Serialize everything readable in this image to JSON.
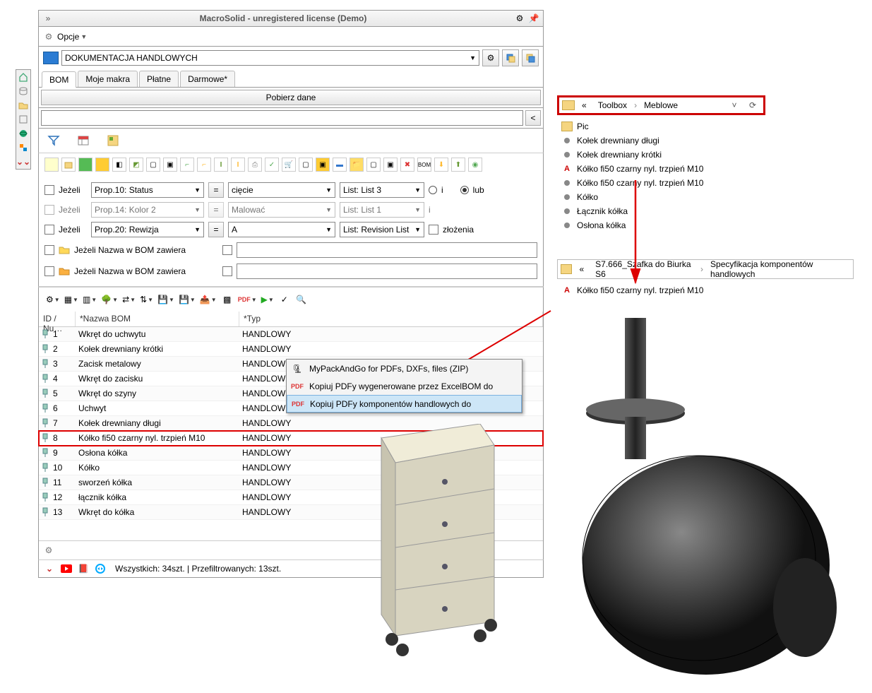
{
  "app": {
    "title": "MacroSolid - unregistered license (Demo)"
  },
  "options": {
    "label": "Opcje"
  },
  "docCombo": {
    "value": "DOKUMENTACJA HANDLOWYCH"
  },
  "tabs": [
    {
      "label": "BOM",
      "active": true
    },
    {
      "label": "Moje makra"
    },
    {
      "label": "Płatne"
    },
    {
      "label": "Darmowe*"
    }
  ],
  "fetch": {
    "label": "Pobierz dane"
  },
  "searchBtn": {
    "label": "<"
  },
  "filters": {
    "jezeli": "Jeżeli",
    "row1": {
      "prop": "Prop.10: Status",
      "op": "=",
      "val": "cięcie",
      "list": "List: List 3"
    },
    "row2": {
      "prop": "Prop.14: Kolor 2",
      "op": "=",
      "val": "Malować",
      "list": "List: List 1"
    },
    "row3": {
      "prop": "Prop.20: Rewizja",
      "op": "=",
      "val": "A",
      "list": "List: Revision List"
    },
    "iLabel": "i",
    "lubLabel": "lub",
    "zlozenia": "złożenia",
    "nameContains": "Jeżeli Nazwa w BOM zawiera"
  },
  "grid": {
    "head": {
      "id": "ID / Nu…",
      "name": "*Nazwa BOM",
      "typ": "*Typ"
    },
    "rows": [
      {
        "id": "1",
        "name": "Wkręt do uchwytu",
        "typ": "HANDLOWY"
      },
      {
        "id": "2",
        "name": "Kołek drewniany krótki",
        "typ": "HANDLOWY"
      },
      {
        "id": "3",
        "name": "Zacisk metalowy",
        "typ": "HANDLOWY"
      },
      {
        "id": "4",
        "name": "Wkręt do zacisku",
        "typ": "HANDLOWY"
      },
      {
        "id": "5",
        "name": "Wkręt do szyny",
        "typ": "HANDLOWY"
      },
      {
        "id": "6",
        "name": "Uchwyt",
        "typ": "HANDLOWY"
      },
      {
        "id": "7",
        "name": "Kołek drewniany długi",
        "typ": "HANDLOWY"
      },
      {
        "id": "8",
        "name": "Kółko fi50 czarny nyl. trzpień M10",
        "typ": "HANDLOWY",
        "hl": true
      },
      {
        "id": "9",
        "name": "Osłona kółka",
        "typ": "HANDLOWY"
      },
      {
        "id": "10",
        "name": "Kółko",
        "typ": "HANDLOWY"
      },
      {
        "id": "11",
        "name": "sworzeń kółka",
        "typ": "HANDLOWY"
      },
      {
        "id": "12",
        "name": "łącznik kółka",
        "typ": "HANDLOWY"
      },
      {
        "id": "13",
        "name": "Wkręt do kółka",
        "typ": "HANDLOWY"
      }
    ]
  },
  "status": {
    "text": "Wszystkich: 34szt. | Przefiltrowanych: 13szt."
  },
  "context": {
    "items": [
      {
        "label": "MyPackAndGo for PDFs, DXFs, files (ZIP)"
      },
      {
        "label": "Kopiuj PDFy wygenerowane przez ExcelBOM do"
      },
      {
        "label": "Kopiuj PDFy komponentów handlowych do",
        "sel": true
      }
    ]
  },
  "explorer1": {
    "crumbs": [
      "«",
      "Toolbox",
      "Meblowe"
    ],
    "items": [
      {
        "ico": "folder",
        "label": "Pic"
      },
      {
        "ico": "part",
        "label": "Kołek drewniany długi"
      },
      {
        "ico": "part",
        "label": "Kołek drewniany krótki"
      },
      {
        "ico": "pdf",
        "label": "Kółko fi50 czarny nyl. trzpień M10"
      },
      {
        "ico": "part",
        "label": "Kółko fi50 czarny nyl. trzpień M10"
      },
      {
        "ico": "part",
        "label": "Kółko"
      },
      {
        "ico": "part",
        "label": "Łącznik kółka"
      },
      {
        "ico": "part",
        "label": "Osłona kółka"
      }
    ]
  },
  "explorer2": {
    "crumbs": [
      "«",
      "S7.666_Szafka do Biurka S6",
      "Specyfikacja komponentów handlowych"
    ],
    "items": [
      {
        "ico": "pdf",
        "label": "Kółko fi50 czarny nyl. trzpień M10"
      }
    ]
  }
}
